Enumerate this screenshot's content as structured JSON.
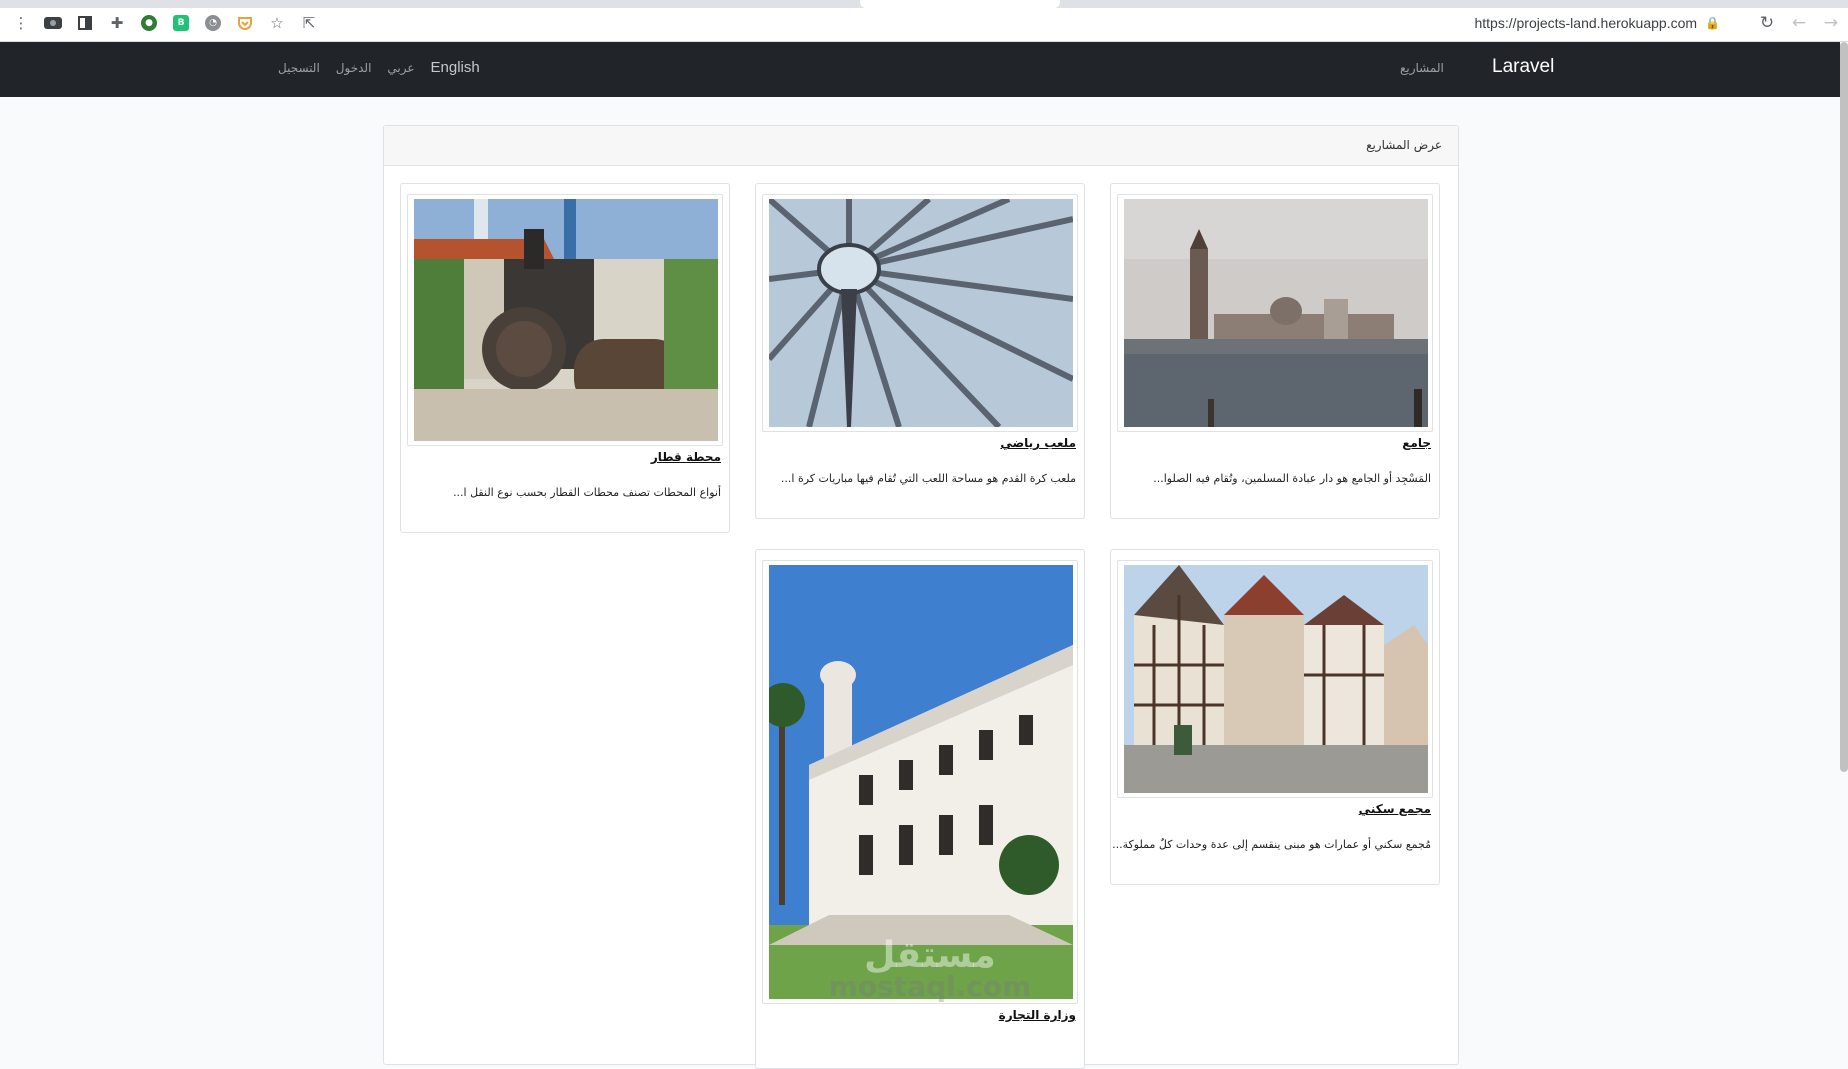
{
  "browser": {
    "url": "https://projects-land.herokuapp.com",
    "icons": [
      "menu-dots-icon",
      "screenshot-icon",
      "side-panel-icon",
      "extensions-icon",
      "ext-green-icon",
      "ext-b-icon",
      "ext-pumpkin-icon",
      "pocket-icon",
      "star-icon",
      "share-icon"
    ]
  },
  "navbar": {
    "brand": "Laravel",
    "projects_link": "المشاريع",
    "register": "التسجيل",
    "login": "الدخول",
    "arabic": "عربي",
    "english": "English"
  },
  "page": {
    "header": "عرض المشاريع"
  },
  "projects": [
    {
      "title": "جامع",
      "description": "المَسْجِد أو الجامع هو دار عبادة المسلمين، وتُقام فيه الصلوا...",
      "image": "venice-church-photo"
    },
    {
      "title": "ملعب رياضي",
      "description": "ملعب كرة القدم هو مساحة اللعب التي تُقام فيها مباريات كرة ا...",
      "image": "stadium-roof-photo"
    },
    {
      "title": "محطة قطار",
      "description": "أنواع المحطات تصنف محطات القطار بحسب نوع النقل ا...",
      "image": "steam-roller-photo"
    },
    {
      "title": "مجمع سكني",
      "description": "مُجمع سكني أو عمارات هو مبنى ينقسم إلى عدة وحدات كلٌ مملوكة...",
      "image": "half-timbered-houses-photo"
    },
    {
      "title": "وزارة التجارة",
      "description": "",
      "image": "white-building-photo"
    }
  ],
  "watermark": {
    "arabic": "مستقل",
    "latin": "mostaql.com"
  },
  "colors": {
    "navbar": "#212529",
    "page_bg": "#f8fafc",
    "card_header": "#f7f7f7"
  }
}
